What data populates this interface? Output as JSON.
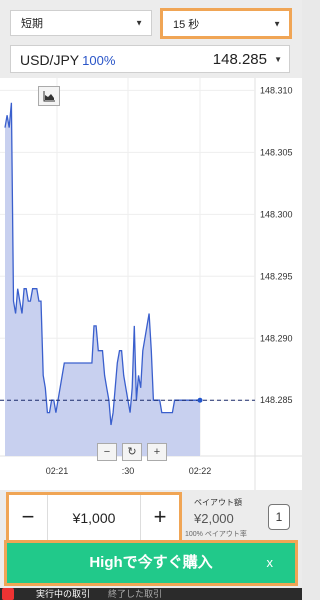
{
  "controls": {
    "mode": "短期",
    "duration": "15 秒",
    "pair": "USD/JPY",
    "pair_pct": "100%",
    "price": "148.285"
  },
  "chart_data": {
    "type": "area",
    "x_ticks": [
      "02:21",
      ":30",
      "02:22"
    ],
    "y_ticks": [
      "148.310",
      "148.305",
      "148.300",
      "148.295",
      "148.290",
      "148.285"
    ],
    "ylim": [
      148.2805,
      148.311
    ],
    "current_price_line": 148.285,
    "x": [
      0,
      1,
      2,
      3,
      4,
      5,
      6,
      7,
      8,
      9,
      10,
      11,
      12,
      13,
      14,
      15,
      16,
      17,
      18,
      19,
      20,
      21,
      22,
      23,
      24,
      25,
      26,
      27,
      28,
      29,
      30,
      31,
      32,
      33,
      34,
      35,
      36,
      37,
      38,
      39,
      40,
      41,
      42,
      43,
      44,
      45,
      46,
      47,
      48,
      49,
      50,
      51,
      52,
      53,
      54,
      55,
      56,
      57,
      58,
      59,
      60,
      61,
      62,
      63,
      64,
      65,
      66,
      67,
      68,
      69,
      70,
      71,
      72,
      73,
      74,
      75,
      76,
      77,
      78,
      79,
      80,
      81,
      82,
      83,
      84,
      85,
      86,
      87,
      88,
      89,
      90,
      91,
      92
    ],
    "values": [
      148.307,
      148.308,
      148.307,
      148.309,
      148.293,
      148.292,
      148.294,
      148.293,
      148.292,
      148.294,
      148.294,
      148.293,
      148.293,
      148.294,
      148.294,
      148.294,
      148.293,
      148.293,
      148.287,
      148.286,
      148.284,
      148.284,
      148.285,
      148.285,
      148.284,
      148.285,
      148.286,
      148.287,
      148.288,
      148.288,
      148.288,
      148.288,
      148.288,
      148.288,
      148.288,
      148.288,
      148.288,
      148.288,
      148.288,
      148.288,
      148.288,
      148.288,
      148.291,
      148.291,
      148.289,
      148.289,
      148.289,
      148.287,
      148.286,
      148.285,
      148.283,
      148.284,
      148.286,
      148.288,
      148.289,
      148.289,
      148.287,
      148.286,
      148.285,
      148.284,
      148.286,
      148.291,
      148.285,
      148.287,
      148.286,
      148.289,
      148.29,
      148.291,
      148.292,
      148.289,
      148.285,
      148.285,
      148.285,
      148.285,
      148.284,
      148.284,
      148.284,
      148.284,
      148.284,
      148.284,
      148.285,
      148.285,
      148.285,
      148.285,
      148.285,
      148.285,
      148.285,
      148.285,
      148.285,
      148.285,
      148.285,
      148.285,
      148.285
    ],
    "line_color": "#3a5fcd",
    "fill_color": "#c8d0ef"
  },
  "zoom": {
    "minus": "−",
    "reset": "↻",
    "plus": "+"
  },
  "trade": {
    "minus": "−",
    "plus": "+",
    "amount": "¥1,000",
    "payout_label": "ペイアウト額",
    "payout_value": "¥2,000",
    "payout_sub": "100% ペイアウト率",
    "expiry_icon": "1",
    "buy_label": "Highで今すぐ購入",
    "close": "x"
  },
  "tabs": {
    "a": "実行中の取引",
    "b": "終了した取引"
  },
  "colors": {
    "accent": "#f0a555",
    "buy": "#21c98a"
  }
}
